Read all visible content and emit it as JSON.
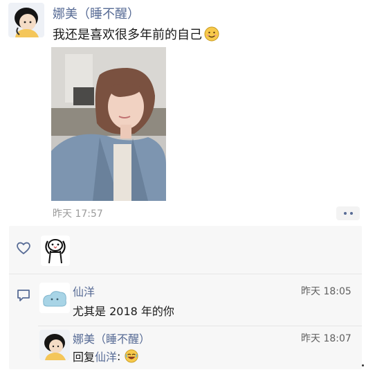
{
  "post": {
    "author": "娜美（睡不醒）",
    "text": "我还是喜欢很多年前的自己",
    "text_emoji": "smile-emoji",
    "time": "昨天 17:57",
    "more_icon": "more-dots-icon"
  },
  "interactions": {
    "like_icon": "heart-icon",
    "comment_icon": "comment-icon",
    "comments": [
      {
        "author": "仙洋",
        "text": "尤其是 2018 年的你",
        "time": "昨天 18:05"
      },
      {
        "author": "娜美（睡不醒）",
        "reply_prefix": "回复",
        "reply_target": "仙洋",
        "reply_colon": ":",
        "emoji": "laughing-emoji",
        "time": "昨天 18:07"
      }
    ]
  },
  "colors": {
    "link": "#576b95",
    "panel": "#f7f7f7",
    "time": "#9a9a9a"
  }
}
